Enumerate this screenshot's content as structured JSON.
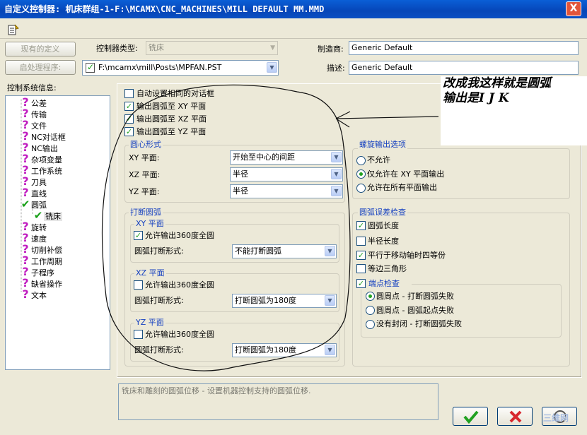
{
  "window": {
    "title": "自定义控制器: 机床群组-1-F:\\MCAMX\\CNC_MACHINES\\MILL DEFAULT MM.MMD",
    "close": "X"
  },
  "toolbar": {
    "icon": "edit-document-icon"
  },
  "buttons": {
    "existing_def": "现有的定义",
    "post_program": "启处理程序:"
  },
  "header": {
    "control_type_label": "控制器类型:",
    "control_type_value": "铣床",
    "post_file": "F:\\mcamx\\mill\\Posts\\MPFAN.PST",
    "manufacturer_label": "制造商:",
    "manufacturer_value": "Generic Default",
    "description_label": "描述:",
    "description_value": "Generic Default"
  },
  "tree": {
    "label": "控制系统信息:",
    "items": [
      {
        "label": "公差",
        "icon": "question-icon"
      },
      {
        "label": "传输",
        "icon": "question-icon"
      },
      {
        "label": "文件",
        "icon": "question-icon"
      },
      {
        "label": "NC对话框",
        "icon": "question-icon"
      },
      {
        "label": "NC输出",
        "icon": "question-icon"
      },
      {
        "label": "杂项变量",
        "icon": "question-icon"
      },
      {
        "label": "工作系统",
        "icon": "question-icon"
      },
      {
        "label": "刀具",
        "icon": "question-icon"
      },
      {
        "label": "直线",
        "icon": "question-icon"
      },
      {
        "label": "圆弧",
        "icon": "check-icon"
      },
      {
        "label": "铣床",
        "icon": "check-icon"
      },
      {
        "label": "旋转",
        "icon": "question-icon"
      },
      {
        "label": "速度",
        "icon": "question-icon"
      },
      {
        "label": "切削补偿",
        "icon": "question-icon"
      },
      {
        "label": "工作周期",
        "icon": "question-icon"
      },
      {
        "label": "子程序",
        "icon": "question-icon"
      },
      {
        "label": "缺省操作",
        "icon": "question-icon"
      },
      {
        "label": "文本",
        "icon": "question-icon"
      }
    ]
  },
  "checks": {
    "auto_same_dialog": {
      "label": "自动设置相同的对话框",
      "checked": false
    },
    "out_xy": {
      "label": "输出圆弧至 XY 平面",
      "checked": true
    },
    "out_xz": {
      "label": "输出圆弧至 XZ 平面",
      "checked": true
    },
    "out_yz": {
      "label": "输出圆弧至 YZ 平面",
      "checked": true
    }
  },
  "center_form": {
    "title": "圆心形式",
    "xy_label": "XY 平面:",
    "xy_value": "开始至中心的间距",
    "xz_label": "XZ 平面:",
    "xz_value": "半径",
    "yz_label": "YZ 平面:",
    "yz_value": "半径"
  },
  "break_arc": {
    "title": "打断圆弧",
    "xy": {
      "title": "XY 平面",
      "allow_label": "允许输出360度全圆",
      "allow_checked": true,
      "form_label": "圆弧打断形式:",
      "form_value": "不能打断圆弧"
    },
    "xz": {
      "title": "XZ 平面",
      "allow_label": "允许输出360度全圆",
      "allow_checked": false,
      "form_label": "圆弧打断形式:",
      "form_value": "打断圆弧为180度"
    },
    "yz": {
      "title": "YZ 平面",
      "allow_label": "允许输出360度全圆",
      "allow_checked": false,
      "form_label": "圆弧打断形式:",
      "form_value": "打断圆弧为180度"
    }
  },
  "helix": {
    "title": "螺旋输出选项",
    "options": [
      "不允许",
      "仅允许在 XY 平面输出",
      "允许在所有平面输出"
    ],
    "selected": 1
  },
  "arc_error": {
    "title": "圆弧误差检查",
    "checks": [
      {
        "label": "圆弧长度",
        "checked": true
      },
      {
        "label": "半径长度",
        "checked": false
      },
      {
        "label": "平行于移动轴时四等份",
        "checked": true
      },
      {
        "label": "等边三角形",
        "checked": false
      }
    ],
    "endpoint": {
      "title": "端点检查",
      "checked": true,
      "options": [
        "圆周点 - 打断圆弧失败",
        "圆周点 - 圆弧起点失败",
        "没有封闭 - 打断圆弧失败"
      ],
      "selected": 0
    }
  },
  "description_text": "铣床和雕刻的圆弧位移 - 设置机器控制支持的圆弧位移.",
  "annotation": {
    "line1": "改成我这样就是圆弧",
    "line2": "输出是I J K"
  },
  "watermark": "三维网",
  "colors": {
    "title_bar": "#0a5fd6",
    "dialog_bg": "#ece9d8",
    "group_title": "#1540c0",
    "check_green": "#21a121",
    "cancel_red": "#d8282e"
  }
}
